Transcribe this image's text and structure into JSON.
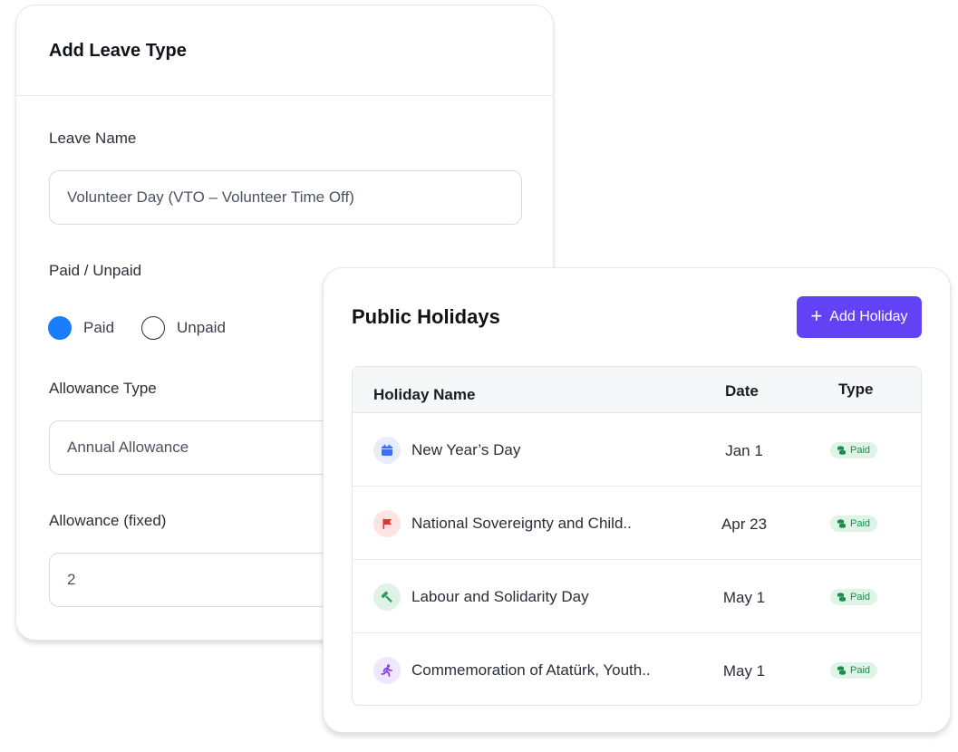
{
  "leave_form": {
    "title": "Add Leave Type",
    "leave_name_label": "Leave Name",
    "leave_name_value": "Volunteer Day (VTO – Volunteer Time Off)",
    "paid_unpaid_label": "Paid / Unpaid",
    "paid_option": "Paid",
    "unpaid_option": "Unpaid",
    "selected_option": "Paid",
    "allowance_type_label": "Allowance Type",
    "allowance_type_value": "Annual Allowance",
    "allowance_fixed_label": "Allowance (fixed)",
    "allowance_fixed_value": "2"
  },
  "holidays": {
    "title": "Public Holidays",
    "add_button_label": "Add Holiday",
    "columns": {
      "name": "Holiday Name",
      "date": "Date",
      "type": "Type"
    },
    "rows": [
      {
        "name": "New Year’s Day",
        "date": "Jan 1",
        "type": "Paid",
        "icon": "calendar-icon",
        "icon_color": "#3b6ff5",
        "icon_bg": "#e9edfb"
      },
      {
        "name": "National Sovereignty and Child..",
        "date": "Apr 23",
        "type": "Paid",
        "icon": "flag-icon",
        "icon_color": "#e5322d",
        "icon_bg": "#fde4e4"
      },
      {
        "name": "Labour and Solidarity Day",
        "date": "May 1",
        "type": "Paid",
        "icon": "hammer-icon",
        "icon_color": "#2f9a58",
        "icon_bg": "#def3e5"
      },
      {
        "name": "Commemoration of Atatürk, Youth..",
        "date": "May 1",
        "type": "Paid",
        "icon": "running-person-icon",
        "icon_color": "#8a3ff0",
        "icon_bg": "#efe7fd"
      }
    ]
  },
  "colors": {
    "primary_button": "#6142f5",
    "radio_selected": "#1a7cff",
    "badge_bg": "#dff4e6",
    "badge_text": "#1f8a4c"
  }
}
